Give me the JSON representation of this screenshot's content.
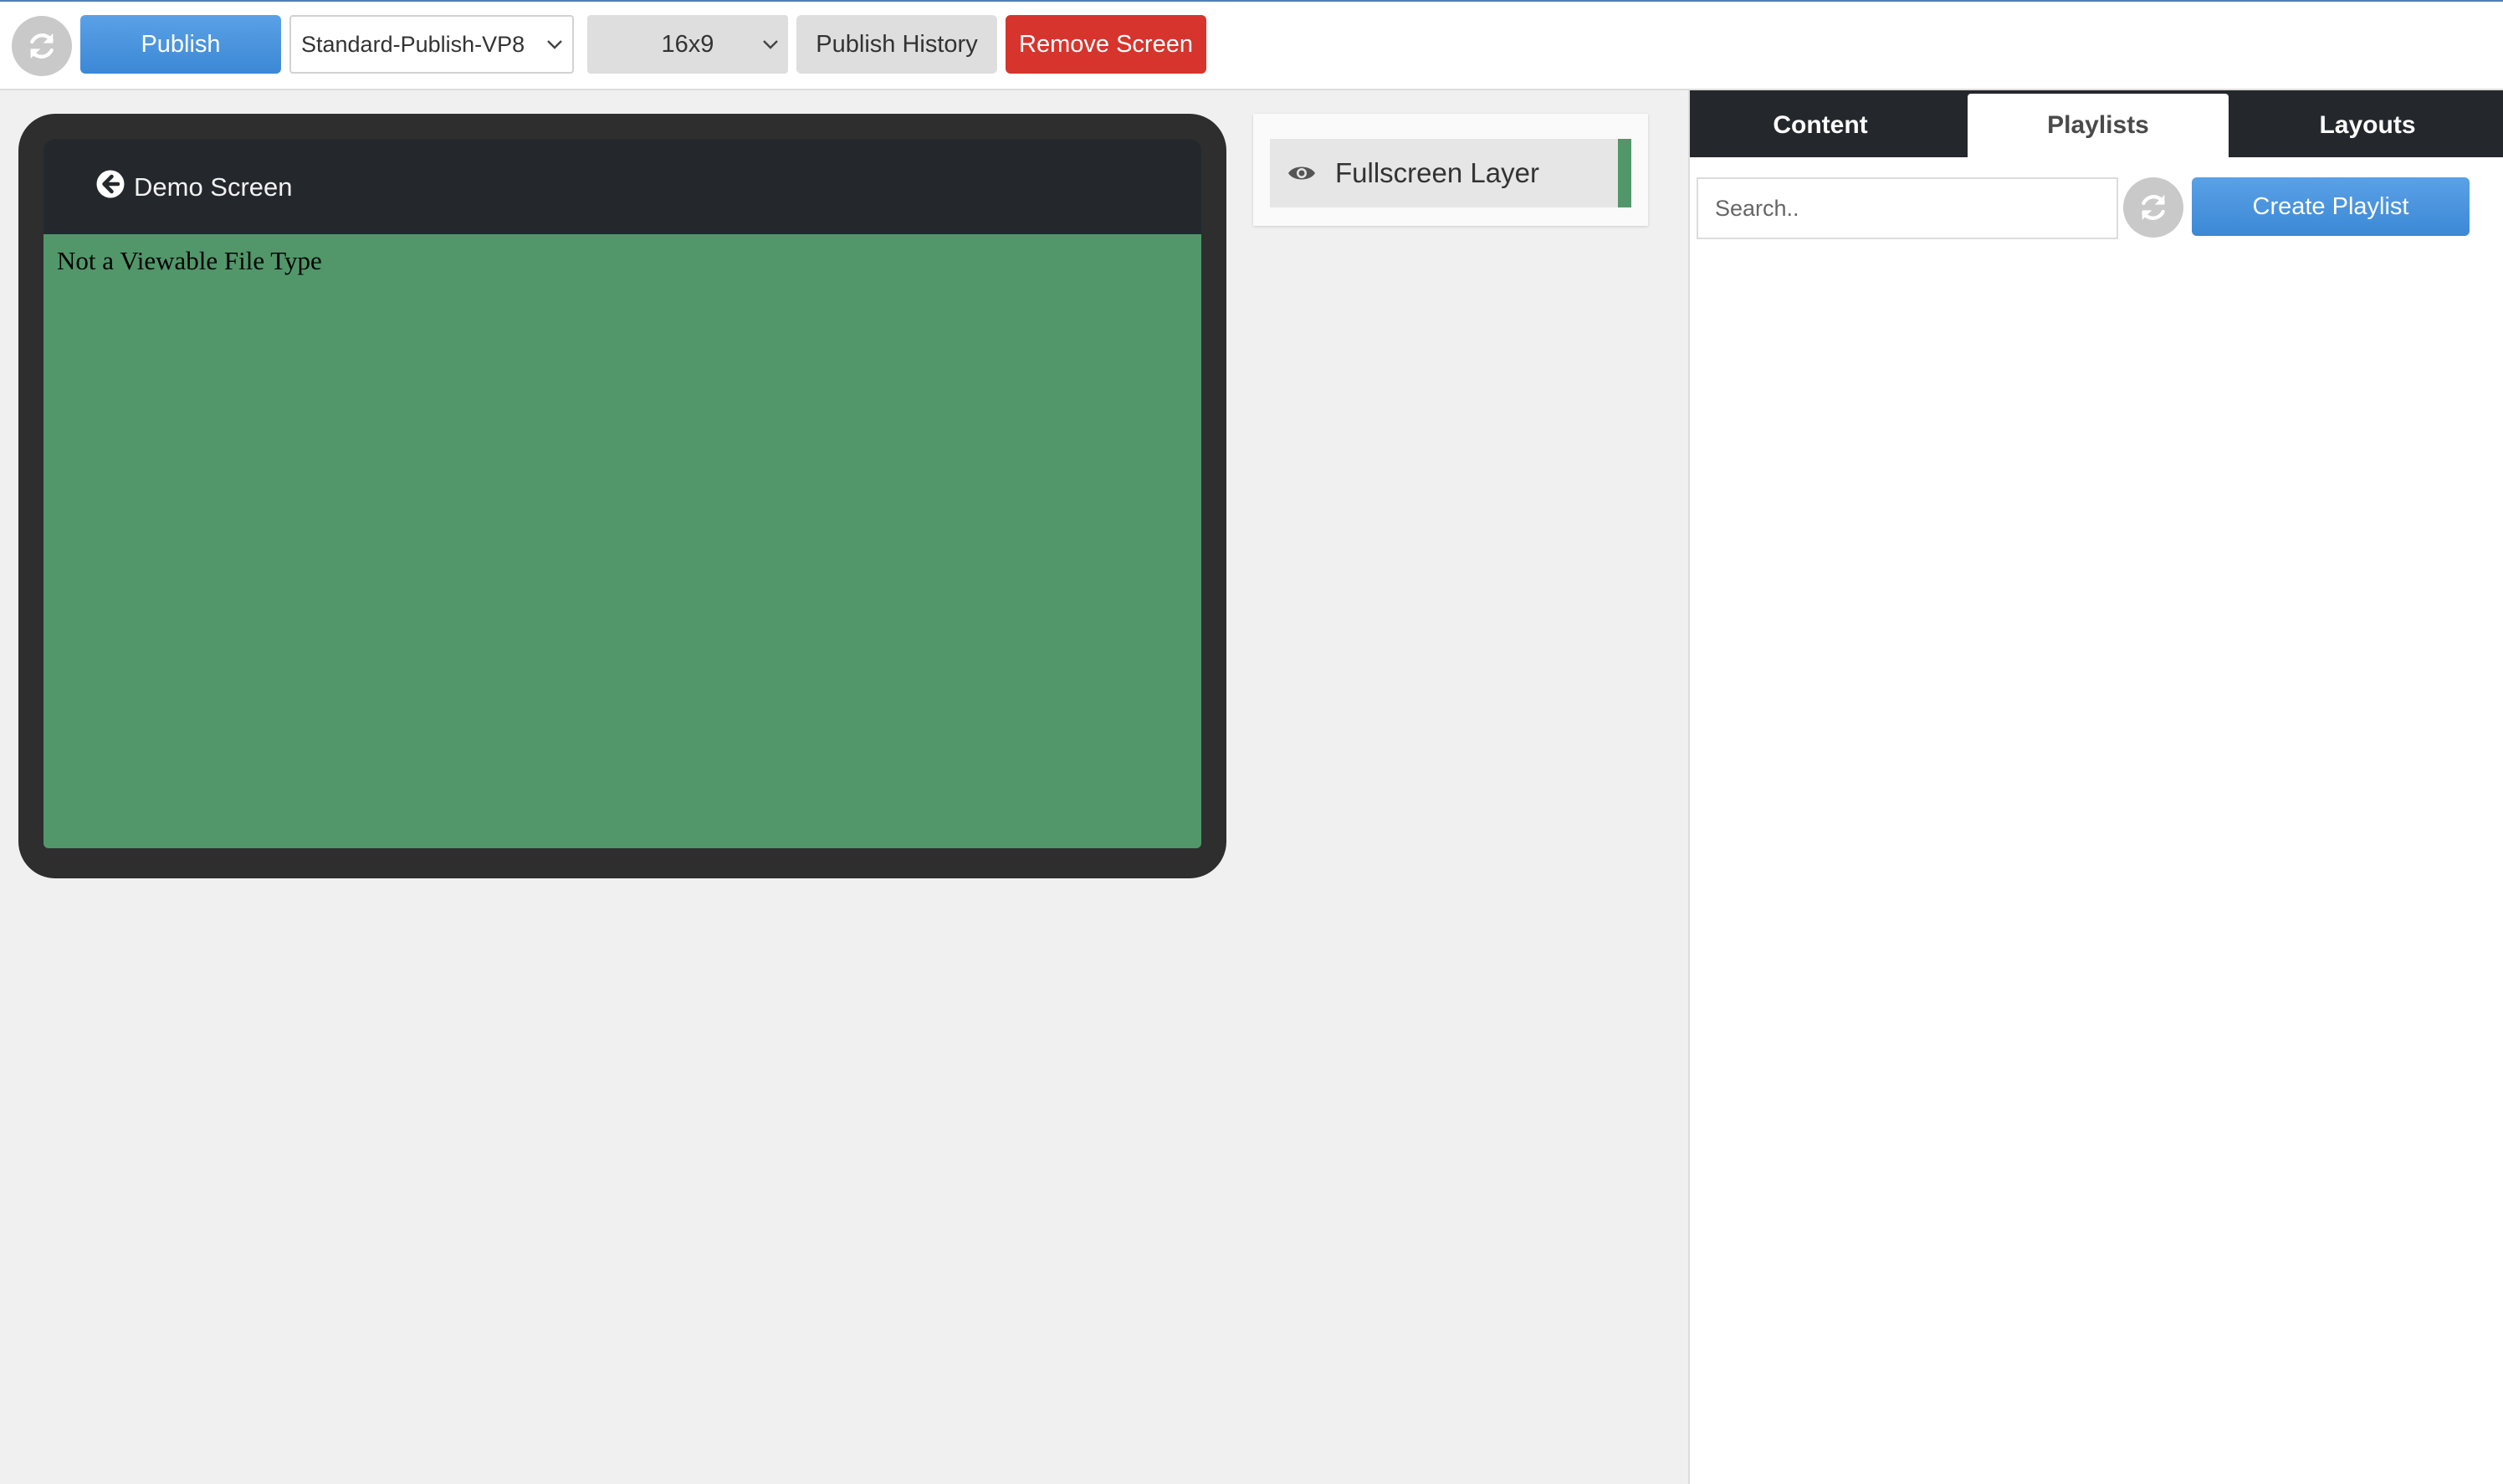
{
  "toolbar": {
    "refresh_icon": "refresh-icon",
    "publish_label": "Publish",
    "profile_select": "Standard-Publish-VP8",
    "aspect_select": "16x9",
    "history_label": "Publish History",
    "remove_label": "Remove Screen"
  },
  "preview": {
    "back_icon": "arrow-left-circle-icon",
    "title": "Demo Screen",
    "message": "Not a Viewable File Type",
    "screen_color": "#52976a"
  },
  "layers": {
    "items": [
      {
        "icon": "eye-icon",
        "label": "Fullscreen Layer",
        "color": "#52976a"
      }
    ]
  },
  "sidepanel": {
    "tabs": [
      {
        "label": "Content",
        "active": false
      },
      {
        "label": "Playlists",
        "active": true
      },
      {
        "label": "Layouts",
        "active": false
      }
    ],
    "search_placeholder": "Search..",
    "create_label": "Create Playlist"
  },
  "colors": {
    "primary": "#3c88d6",
    "danger": "#d6342c",
    "dark": "#24282d"
  }
}
